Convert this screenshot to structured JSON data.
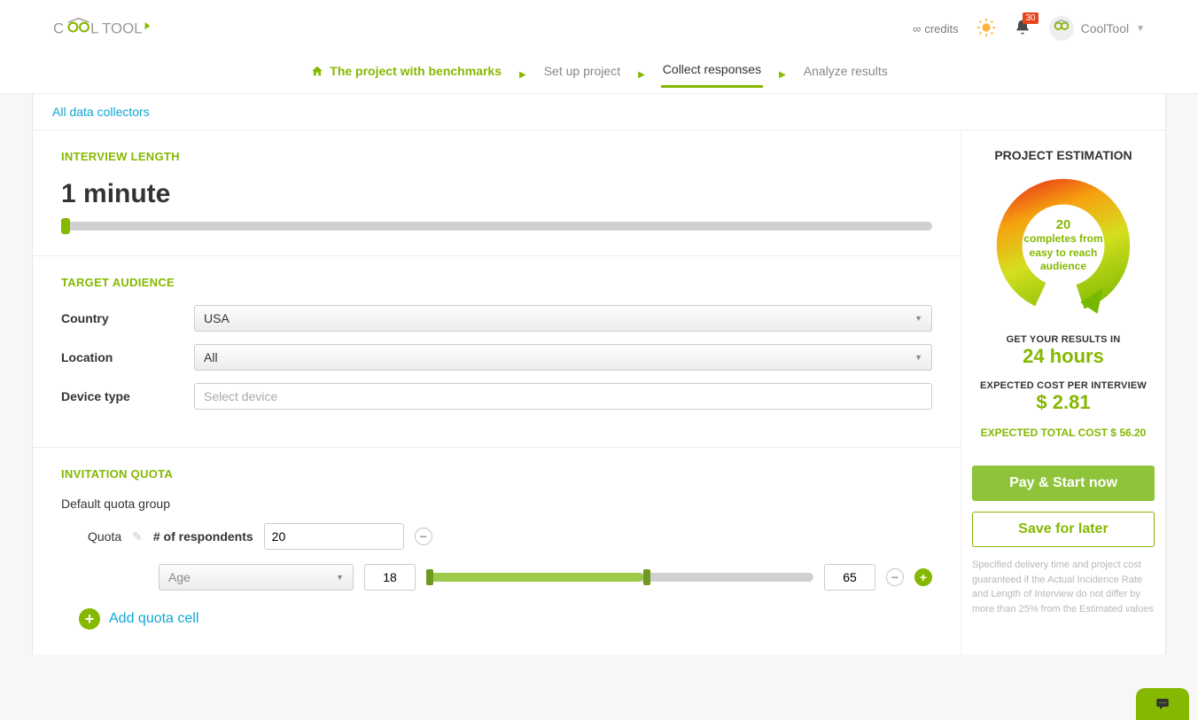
{
  "header": {
    "credits_label": "credits",
    "notification_count": "30",
    "username": "CoolTool"
  },
  "breadcrumb": {
    "project_name": "The project with benchmarks",
    "steps": [
      "Set up project",
      "Collect responses",
      "Analyze results"
    ],
    "active_index": 1
  },
  "nav_link": "All data collectors",
  "interview_length": {
    "title": "INTERVIEW LENGTH",
    "value": "1 minute"
  },
  "target_audience": {
    "title": "TARGET AUDIENCE",
    "country_label": "Country",
    "country_value": "USA",
    "location_label": "Location",
    "location_value": "All",
    "device_label": "Device type",
    "device_placeholder": "Select device"
  },
  "invitation_quota": {
    "title": "INVITATION QUOTA",
    "group_title": "Default quota group",
    "quota_label": "Quota",
    "respondents_label": "# of respondents",
    "respondents_value": "20",
    "age_label": "Age",
    "age_min": "18",
    "age_max": "65",
    "add_cell": "Add quota cell"
  },
  "estimation": {
    "title": "PROJECT ESTIMATION",
    "completes_count": "20",
    "completes_text": "completes from easy to reach audience",
    "results_caption": "GET YOUR RESULTS IN",
    "results_value": "24 hours",
    "cost_caption": "EXPECTED COST PER INTERVIEW",
    "cost_value": "$ 2.81",
    "total_cost": "EXPECTED TOTAL COST $ 56.20",
    "pay_button": "Pay & Start now",
    "save_button": "Save for later",
    "disclaimer": "Specified delivery time and project cost guaranteed if the Actual Incidence Rate and Length of Interview do not differ by more than 25% from the Estimated values"
  }
}
